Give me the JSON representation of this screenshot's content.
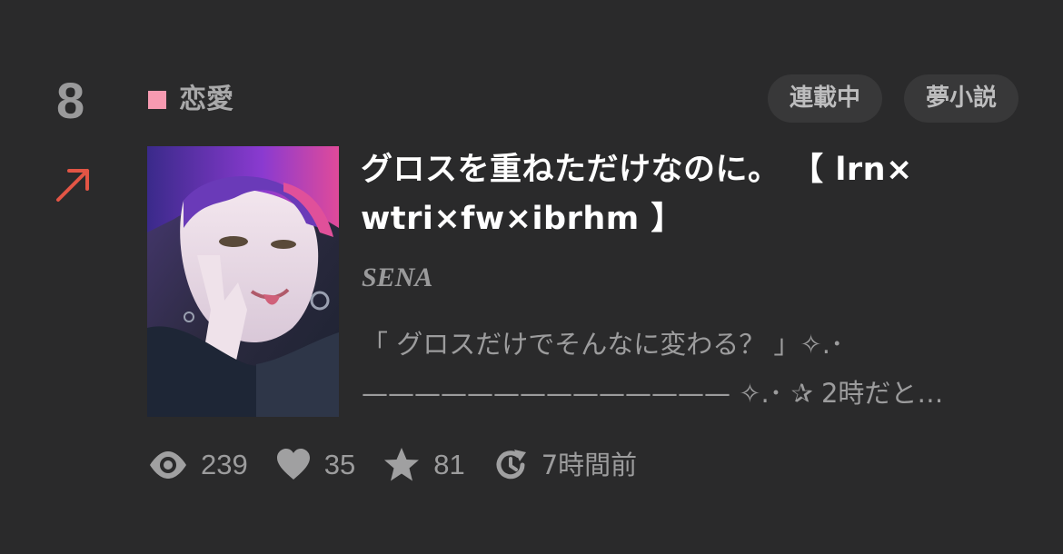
{
  "ranking": {
    "position": "8",
    "trend_icon": "arrow-up-right-icon",
    "trend_color": "#e25545"
  },
  "genre": {
    "label": "恋愛",
    "color": "#f79ab1"
  },
  "badges": [
    {
      "label": "連載中"
    },
    {
      "label": "夢小説"
    }
  ],
  "story": {
    "title": "グロスを重ねただけなのに。 【 lrn× wtri×fw×ibrhm 】",
    "author": "SENA",
    "summary_line1": "「 グロスだけでそんなに変わる？ 」✧.･",
    "summary_line2": "—————————————— ✧.･ ✰ 2時だと…"
  },
  "stats": {
    "views": "239",
    "likes": "35",
    "stars": "81",
    "updated": "7時間前"
  },
  "colors": {
    "background": "#2a2a2b",
    "badge_background": "#383839",
    "muted_text": "#9c9c9d"
  }
}
